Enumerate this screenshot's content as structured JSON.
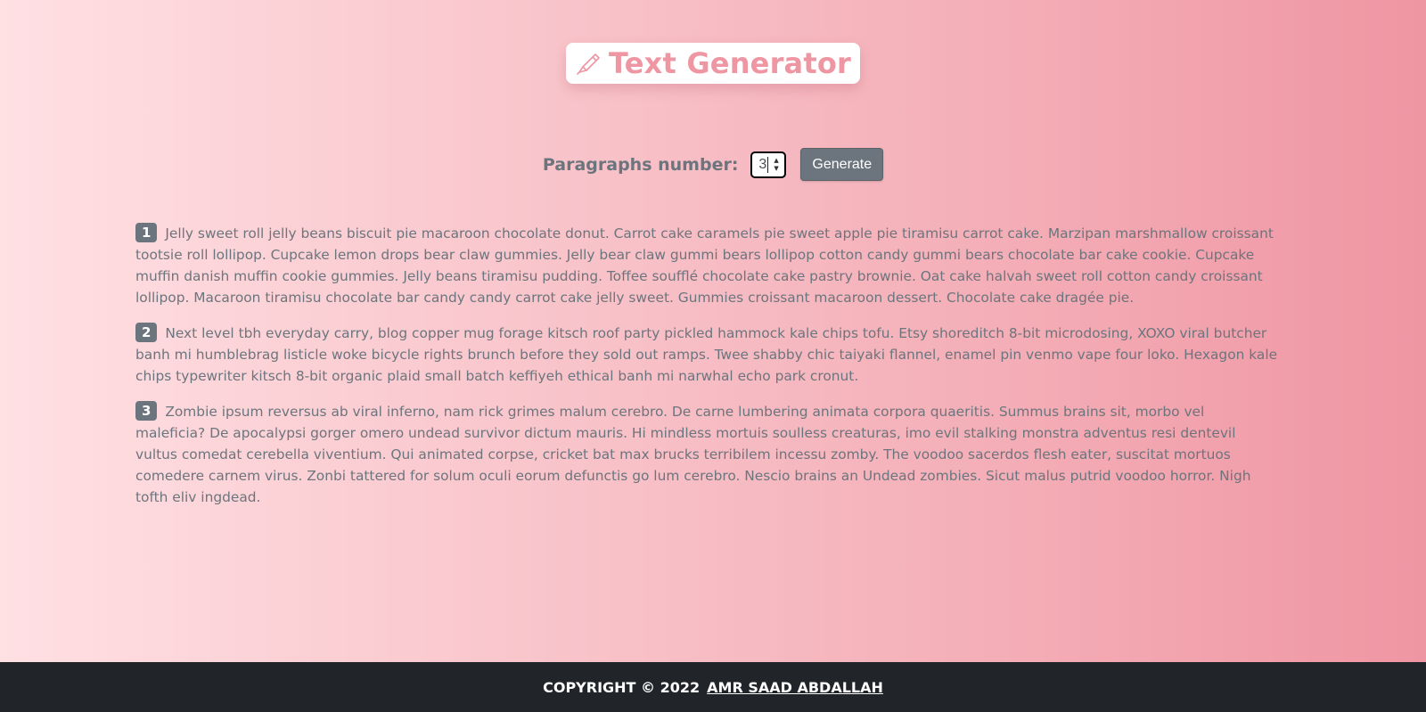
{
  "header": {
    "title": "Text Generator",
    "icon": "pen-icon",
    "accent_color": "#ef96a3"
  },
  "controls": {
    "label": "Paragraphs number:",
    "value": "3",
    "generate_label": "Generate"
  },
  "paragraphs": [
    {
      "number": "1",
      "text": "Jelly sweet roll jelly beans biscuit pie macaroon chocolate donut. Carrot cake caramels pie sweet apple pie tiramisu carrot cake. Marzipan marshmallow croissant tootsie roll lollipop. Cupcake lemon drops bear claw gummies. Jelly bear claw gummi bears lollipop cotton candy gummi bears chocolate bar cake cookie. Cupcake muffin danish muffin cookie gummies. Jelly beans tiramisu pudding. Toffee soufflé chocolate cake pastry brownie. Oat cake halvah sweet roll cotton candy croissant lollipop. Macaroon tiramisu chocolate bar candy candy carrot cake jelly sweet. Gummies croissant macaroon dessert. Chocolate cake dragée pie."
    },
    {
      "number": "2",
      "text": "Next level tbh everyday carry, blog copper mug forage kitsch roof party pickled hammock kale chips tofu. Etsy shoreditch 8-bit microdosing, XOXO viral butcher banh mi humblebrag listicle woke bicycle rights brunch before they sold out ramps. Twee shabby chic taiyaki flannel, enamel pin venmo vape four loko. Hexagon kale chips typewriter kitsch 8-bit organic plaid small batch keffiyeh ethical banh mi narwhal echo park cronut."
    },
    {
      "number": "3",
      "text": "Zombie ipsum reversus ab viral inferno, nam rick grimes malum cerebro. De carne lumbering animata corpora quaeritis. Summus brains sit, morbo vel maleficia? De apocalypsi gorger omero undead survivor dictum mauris. Hi mindless mortuis soulless creaturas, imo evil stalking monstra adventus resi dentevil vultus comedat cerebella viventium. Qui animated corpse, cricket bat max brucks terribilem incessu zomby. The voodoo sacerdos flesh eater, suscitat mortuos comedere carnem virus. Zonbi tattered for solum oculi eorum defunctis go lum cerebro. Nescio brains an Undead zombies. Sicut malus putrid voodoo horror. Nigh tofth eliv ingdead."
    }
  ],
  "footer": {
    "copyright": "COPYRIGHT © 2022",
    "author": "AMR SAAD ABDALLAH"
  }
}
